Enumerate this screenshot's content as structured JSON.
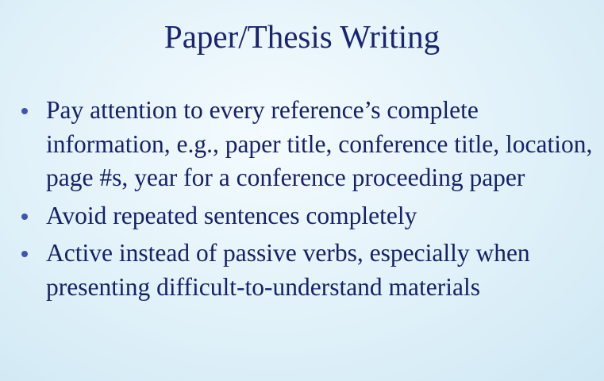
{
  "slide": {
    "title": "Paper/Thesis Writing",
    "bullets": [
      "Pay attention to every reference’s complete information, e.g., paper title, conference title, location, page #s, year for a conference proceeding paper",
      "Avoid repeated sentences completely",
      "Active instead of passive verbs, especially when presenting difficult-to-understand materials"
    ]
  },
  "colors": {
    "background": "#e4f3fa",
    "text": "#16216a",
    "bullet": "#3d55b0"
  }
}
